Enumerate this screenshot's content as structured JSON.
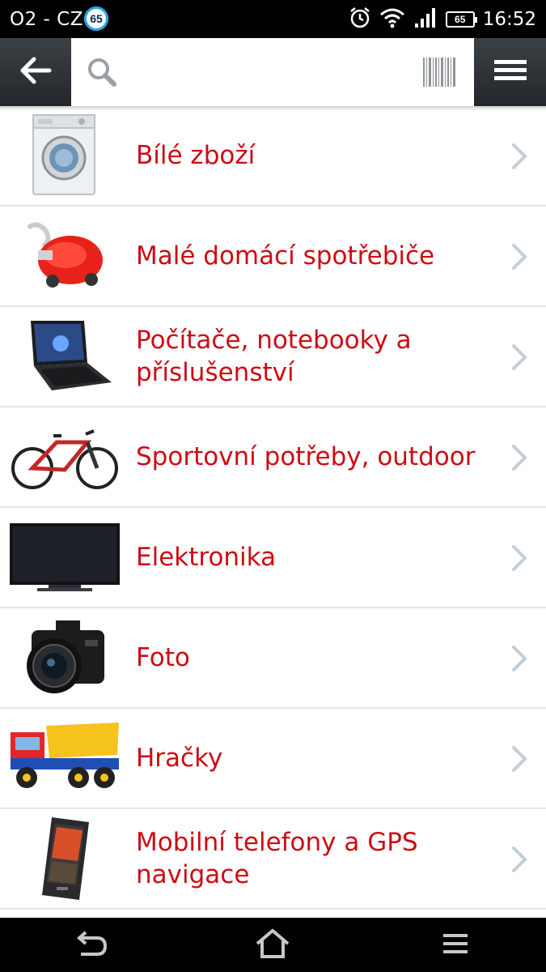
{
  "status_bar": {
    "carrier": "O2 - CZ",
    "notification_badge": "65",
    "battery": "65",
    "time": "16:52"
  },
  "toolbar": {
    "search_placeholder": "",
    "icons": [
      "back-arrow-icon",
      "search-icon",
      "barcode-icon",
      "hamburger-menu-icon"
    ]
  },
  "categories": [
    {
      "label": "Bílé zboží",
      "icon": "washing-machine-image"
    },
    {
      "label": "Malé domácí spotřebiče",
      "icon": "vacuum-cleaner-image"
    },
    {
      "label": "Počítače, notebooky a příslušenství",
      "icon": "laptop-image"
    },
    {
      "label": "Sportovní potřeby, outdoor",
      "icon": "bicycle-image"
    },
    {
      "label": "Elektronika",
      "icon": "tv-image"
    },
    {
      "label": "Foto",
      "icon": "camera-image"
    },
    {
      "label": "Hračky",
      "icon": "toy-truck-image"
    },
    {
      "label": "Mobilní telefony a GPS navigace",
      "icon": "mobile-phone-image"
    }
  ],
  "colors": {
    "category_text": "#cc0c14",
    "toolbar": "#2e3338",
    "divider": "#dfe7ee"
  },
  "nav_bar": {
    "icons": [
      "back-nav-icon",
      "home-icon",
      "recent-apps-icon"
    ]
  }
}
